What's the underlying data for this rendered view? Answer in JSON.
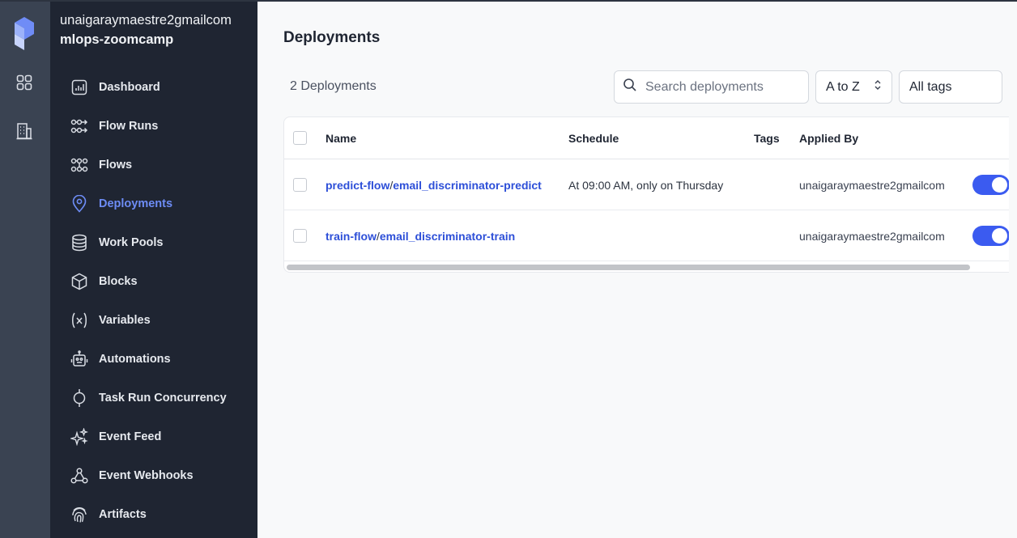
{
  "workspace": {
    "account": "unaigaraymaestre2gmailcom",
    "name": "mlops-zoomcamp"
  },
  "nav": {
    "items": [
      {
        "label": "Dashboard",
        "icon": "dashboard-chart-icon"
      },
      {
        "label": "Flow Runs",
        "icon": "flow-runs-icon"
      },
      {
        "label": "Flows",
        "icon": "flows-icon"
      },
      {
        "label": "Deployments",
        "icon": "map-pin-icon",
        "active": true
      },
      {
        "label": "Work Pools",
        "icon": "database-stack-icon"
      },
      {
        "label": "Blocks",
        "icon": "cube-icon"
      },
      {
        "label": "Variables",
        "icon": "variable-icon"
      },
      {
        "label": "Automations",
        "icon": "robot-icon"
      },
      {
        "label": "Task Run Concurrency",
        "icon": "concurrency-icon"
      },
      {
        "label": "Event Feed",
        "icon": "sparkles-icon"
      },
      {
        "label": "Event Webhooks",
        "icon": "webhook-icon"
      },
      {
        "label": "Artifacts",
        "icon": "fingerprint-icon"
      }
    ]
  },
  "page": {
    "title": "Deployments",
    "count": "2 Deployments"
  },
  "filters": {
    "search_placeholder": "Search deployments",
    "sort_value": "A to Z",
    "tags_value": "All tags"
  },
  "table": {
    "columns": [
      "Name",
      "Schedule",
      "Tags",
      "Applied By"
    ],
    "rows": [
      {
        "flow": "predict-flow",
        "sep": "/",
        "deployment": "email_discriminator-predict",
        "schedule": "At 09:00 AM, only on Thursday",
        "tags": "",
        "applied_by": "unaigaraymaestre2gmailcom",
        "active": true
      },
      {
        "flow": "train-flow",
        "sep": "/",
        "deployment": "email_discriminator-train",
        "schedule": "",
        "tags": "",
        "applied_by": "unaigaraymaestre2gmailcom",
        "active": true
      }
    ]
  },
  "colors": {
    "accent": "#3b5bf0",
    "link": "#2d4fd8",
    "sidebar_bg": "#1f2532",
    "rail_bg": "#3a4352"
  }
}
